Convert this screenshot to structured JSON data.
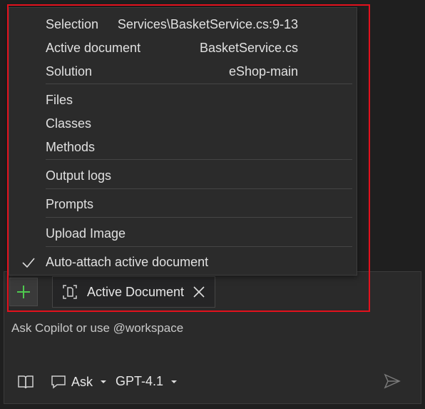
{
  "menu": {
    "context_items": [
      {
        "label": "Selection",
        "value": "Services\\BasketService.cs:9-13"
      },
      {
        "label": "Active document",
        "value": "BasketService.cs"
      },
      {
        "label": "Solution",
        "value": "eShop-main"
      }
    ],
    "code_items": [
      {
        "label": "Files"
      },
      {
        "label": "Classes"
      },
      {
        "label": "Methods"
      }
    ],
    "output_logs": "Output logs",
    "prompts": "Prompts",
    "upload_image": "Upload Image",
    "auto_attach": "Auto-attach active document",
    "auto_attach_checked": true
  },
  "attachments": {
    "add_icon": "plus-icon",
    "chip_label": "Active Document",
    "chip_icon": "document-scope-icon"
  },
  "input": {
    "placeholder": "Ask Copilot or use @workspace"
  },
  "toolbar": {
    "mode_label": "Ask",
    "model_label": "GPT-4.1"
  },
  "colors": {
    "background": "#1f1f1f",
    "menu_bg": "#2b2b2b",
    "accent_plus": "#4ec94e",
    "highlight_border": "#e3111d"
  }
}
